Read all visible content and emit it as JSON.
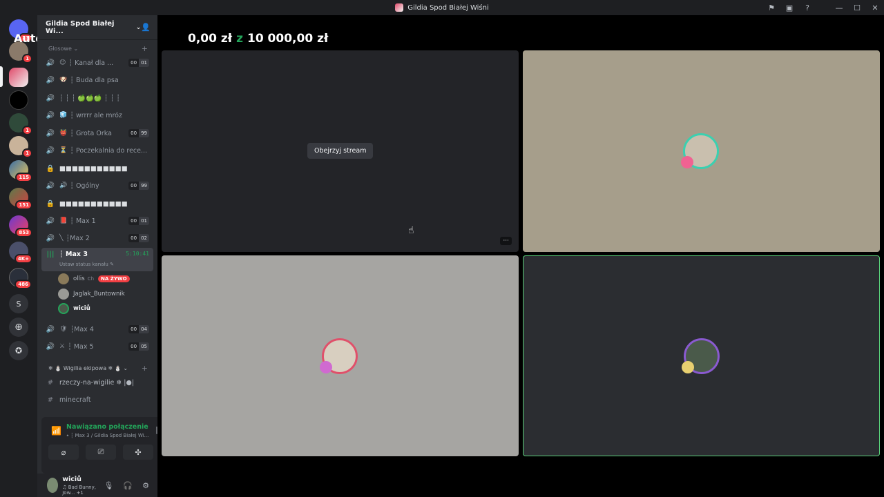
{
  "window": {
    "title": "Gildia Spod Białej Wiśni"
  },
  "overlay": {
    "auto_label": "Auto"
  },
  "rail": {
    "badges": [
      "23",
      "1",
      "1",
      "1",
      "115",
      "151",
      "853",
      "4K+",
      "486"
    ],
    "letter_server": "S"
  },
  "guild": {
    "name": "Gildia Spod Białej Wi..."
  },
  "category": {
    "voice": "Głosowe",
    "wigilia": "Wigilia ekipowa"
  },
  "channels": [
    {
      "emoji": "😊",
      "name": "┆ Kanał dla ...",
      "c1": "00",
      "c2": "01"
    },
    {
      "emoji": "🐶",
      "name": "┆ Buda dla psa",
      "c1": "",
      "c2": ""
    },
    {
      "emoji": "",
      "name": "┆ ┆ ┆ 🍏🍏🍏 ┆ ┆ ┆",
      "c1": "",
      "c2": ""
    },
    {
      "emoji": "🧊",
      "name": "┆ wrrrr ale mróz",
      "c1": "",
      "c2": ""
    },
    {
      "emoji": "👹",
      "name": "┆ Grota Orka",
      "c1": "00",
      "c2": "99"
    },
    {
      "emoji": "⏳",
      "name": "┆ Poczekalnia do rece...",
      "c1": "",
      "c2": ""
    },
    {
      "emoji": "",
      "name": "■■■■■■■■■■■",
      "c1": "",
      "c2": ""
    },
    {
      "emoji": "🔊",
      "name": "┆ Ogólny",
      "c1": "00",
      "c2": "99"
    },
    {
      "emoji": "",
      "name": "■■■■■■■■■■■",
      "c1": "",
      "c2": ""
    },
    {
      "emoji": "📕",
      "name": "┆ Max 1",
      "c1": "00",
      "c2": "01"
    },
    {
      "emoji": "╲",
      "name": "┆Max 2",
      "c1": "00",
      "c2": "02"
    }
  ],
  "active_channel": {
    "name": "┆ Max 3",
    "time": "5:10:41",
    "status": "Ustaw status kanału"
  },
  "members": [
    {
      "name": "ollis",
      "extra": "Ch",
      "live": "NA ŻYWO"
    },
    {
      "name": "Jaglak_Buntownik"
    },
    {
      "name": "wiciů"
    }
  ],
  "channels_after": [
    {
      "emoji": "🛡",
      "name": "┆Max 4",
      "c1": "00",
      "c2": "04"
    },
    {
      "emoji": "⚔",
      "name": "┆ Max 5",
      "c1": "00",
      "c2": "05"
    }
  ],
  "text_channels": [
    {
      "name": "rzeczy-na-wigilie ❄ |●|"
    },
    {
      "name": "minecraft"
    }
  ],
  "voice_panel": {
    "status": "Nawiązano połączenie",
    "location": "⭑ ┆ Max 3 / Gildia Spod Białej Wi..."
  },
  "user": {
    "name": "wiciů",
    "activity": "Bad Bunny, Jow...",
    "plus": "+1"
  },
  "stage": {
    "money_current": "0,00 zł",
    "money_sep": "z",
    "money_goal": "10 000,00 zł",
    "watch_stream": "Obejrzyj stream",
    "more": "···"
  },
  "colors": {
    "accent_green": "#23a55a",
    "danger": "#f23f43",
    "bg_dark": "#1e1f22",
    "sidebar": "#2b2d31"
  }
}
